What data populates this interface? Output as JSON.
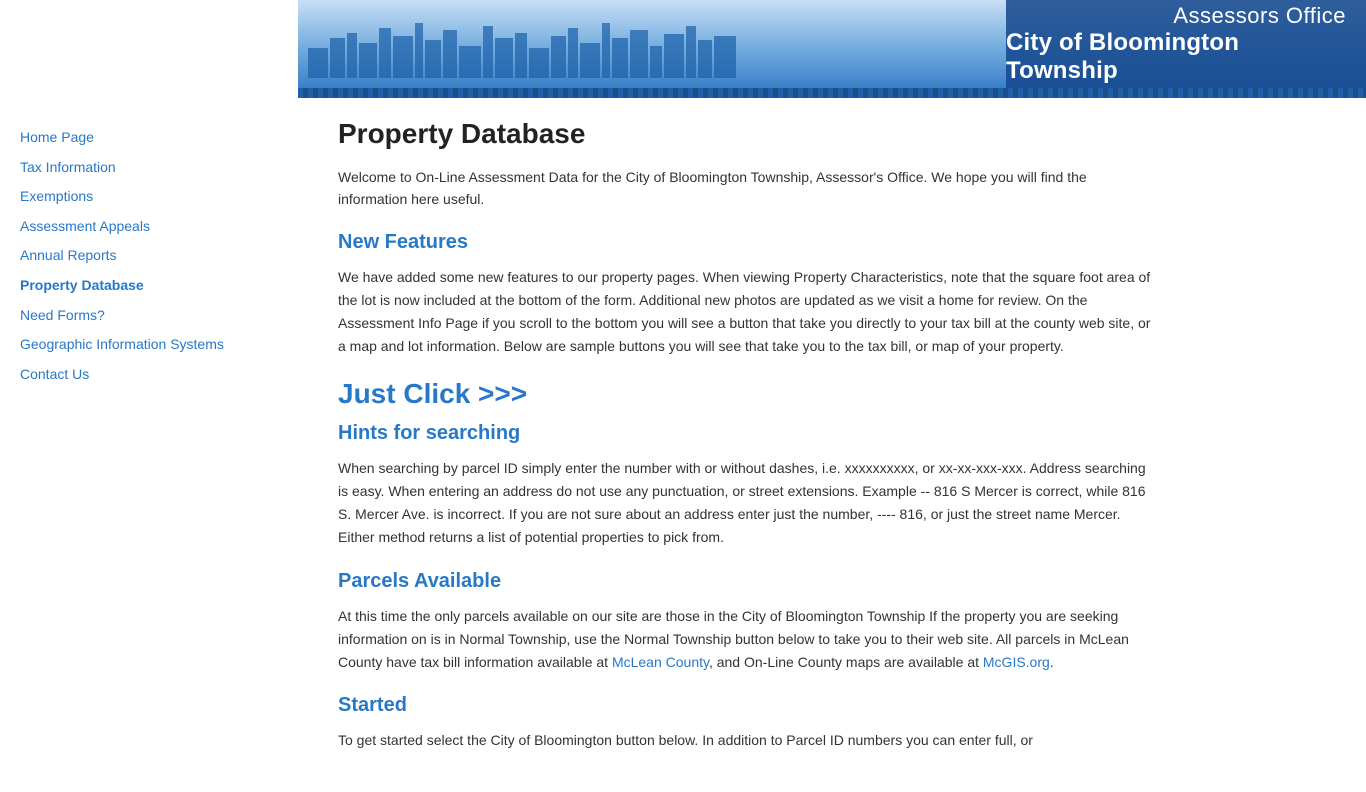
{
  "header": {
    "title_line1": "Assessors Office",
    "title_line2": "City of Bloomington Township"
  },
  "sidebar": {
    "items": [
      {
        "label": "Home Page",
        "href": "#home",
        "active": false
      },
      {
        "label": "Tax Information",
        "href": "#tax",
        "active": false
      },
      {
        "label": "Exemptions",
        "href": "#exemptions",
        "active": false
      },
      {
        "label": "Assessment Appeals",
        "href": "#appeals",
        "active": false
      },
      {
        "label": "Annual Reports",
        "href": "#reports",
        "active": false
      },
      {
        "label": "Property Database",
        "href": "#db",
        "active": true
      },
      {
        "label": "Need Forms?",
        "href": "#forms",
        "active": false
      },
      {
        "label": "Geographic Information Systems",
        "href": "#gis",
        "active": false
      },
      {
        "label": "Contact Us",
        "href": "#contact",
        "active": false
      }
    ]
  },
  "main": {
    "page_title": "Property Database",
    "intro_text": "Welcome to On-Line Assessment Data for the City of Bloomington Township, Assessor's Office. We hope you will find the information here useful.",
    "sections": [
      {
        "id": "new-features",
        "heading": "New Features",
        "heading_size": "normal",
        "body": "We have added some new features to our property pages. When viewing Property Characteristics, note that the square foot area of the lot is now included at the bottom of the form. Additional new photos are updated as we visit a home for review. On the Assessment Info Page if you scroll to the bottom you will see a button that take you directly to your tax bill at the county web site, or a map and lot information. Below are sample buttons you will see that take you to the tax bill, or map of your property."
      },
      {
        "id": "just-click",
        "heading": "Just Click >>>",
        "heading_size": "large",
        "body": ""
      },
      {
        "id": "hints",
        "heading": "Hints for searching",
        "heading_size": "normal",
        "body": "When searching by parcel ID simply enter the number with or without dashes, i.e. xxxxxxxxxx, or xx-xx-xxx-xxx. Address searching is easy. When entering an address do not use any punctuation, or street extensions. Example -- 816 S Mercer is correct, while 816 S. Mercer Ave. is incorrect. If you are not sure about an address enter just the number, ---- 816, or just the street name Mercer. Either method returns a list of potential properties to pick from."
      },
      {
        "id": "parcels",
        "heading": "Parcels Available",
        "heading_size": "normal",
        "body_parts": [
          "At this time the only parcels available on our site are those in the City of Bloomington Township If the property you are seeking information on is in Normal Township, use the Normal Township button below to take you to their web site. All parcels in McLean County have tax bill information available at ",
          "McLean County",
          ", and On-Line County maps are available at ",
          "McGIS.org",
          "."
        ],
        "links": [
          {
            "text": "McLean County",
            "href": "#mclean"
          },
          {
            "text": "McGIS.org",
            "href": "#mcgis"
          }
        ]
      },
      {
        "id": "started",
        "heading": "Started",
        "heading_size": "normal",
        "body": "To get started select the City of Bloomington button below. In addition to Parcel ID numbers you can enter full, or"
      }
    ]
  }
}
